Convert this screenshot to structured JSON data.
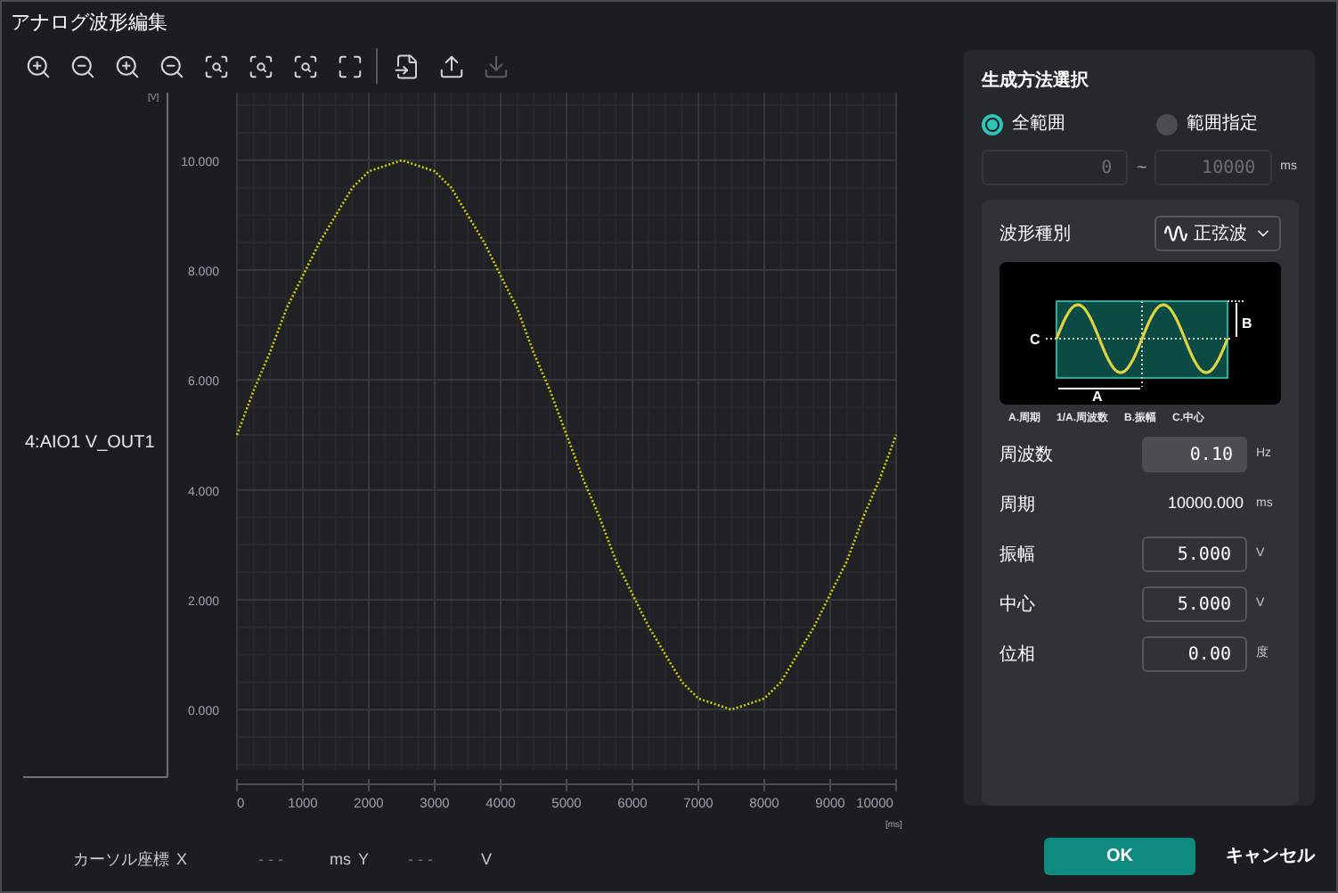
{
  "window": {
    "title": "アナログ波形編集"
  },
  "toolbar_groups": [
    [
      {
        "kind": "zoom-in",
        "disabled": false
      },
      {
        "kind": "zoom-out",
        "disabled": false
      },
      {
        "kind": "zoom-in",
        "disabled": false
      },
      {
        "kind": "zoom-out",
        "disabled": false
      },
      {
        "kind": "zoom-area",
        "disabled": false
      },
      {
        "kind": "zoom-area",
        "disabled": false
      },
      {
        "kind": "zoom-area",
        "disabled": false
      },
      {
        "kind": "fit",
        "disabled": false
      }
    ],
    [
      {
        "kind": "value",
        "disabled": false
      },
      {
        "kind": "export",
        "disabled": false
      },
      {
        "kind": "import",
        "disabled": true
      }
    ]
  ],
  "chart_data": {
    "type": "line",
    "xlabel": "[ms]",
    "ylabel": "[V]",
    "grid": true,
    "x": [
      0,
      250,
      500,
      750,
      1000,
      1250,
      1500,
      1750,
      2000,
      2250,
      2500,
      2750,
      3000,
      3250,
      3500,
      3750,
      4000,
      4250,
      4500,
      4750,
      5000,
      5250,
      5500,
      5750,
      6000,
      6250,
      6500,
      6750,
      7000,
      7250,
      7500,
      7750,
      8000,
      8250,
      8500,
      8750,
      9000,
      9250,
      9500,
      9750,
      10000
    ],
    "series": [
      {
        "name": "4:AIO1 V_OUT1",
        "color": "#d4d000",
        "line_style": "dotted",
        "values": [
          5,
          5.8,
          6.5,
          7.3,
          7.9,
          8.5,
          9,
          9.5,
          9.8,
          9.9,
          10,
          9.9,
          9.8,
          9.5,
          9,
          8.5,
          7.9,
          7.3,
          6.5,
          5.8,
          5,
          4.2,
          3.5,
          2.7,
          2.1,
          1.5,
          1,
          0.5,
          0.2,
          0.1,
          0,
          0.1,
          0.2,
          0.5,
          1,
          1.5,
          2.1,
          2.7,
          3.5,
          4.2,
          5
        ]
      }
    ],
    "xlim": [
      0,
      10000
    ],
    "ylim": [
      -1.1,
      11.23
    ],
    "xticks": [
      0,
      1000,
      2000,
      3000,
      4000,
      5000,
      6000,
      7000,
      8000,
      9000,
      10000
    ],
    "yticks": [
      {
        "value": 0,
        "label": "0.000"
      },
      {
        "value": 2,
        "label": "2.000"
      },
      {
        "value": 4,
        "label": "4.000"
      },
      {
        "value": 6,
        "label": "6.000"
      },
      {
        "value": 8,
        "label": "8.000"
      },
      {
        "value": 10,
        "label": "10.000"
      }
    ]
  },
  "cursor": {
    "label": "カーソル座標",
    "x_label": "X",
    "x_value": "- - -",
    "x_unit": "ms",
    "y_label": "Y",
    "y_value": "- - -",
    "y_unit": "V"
  },
  "panel": {
    "title": "生成方法選択",
    "modes": [
      {
        "label": "全範囲",
        "selected": true
      },
      {
        "label": "範囲指定",
        "selected": false
      }
    ],
    "range": {
      "start": "0",
      "separator": "~",
      "end": "10000",
      "unit": "ms",
      "disabled": true
    },
    "wave_type": {
      "label": "波形種別",
      "value": "正弦波"
    },
    "diagram": {
      "label_a": "A",
      "label_b": "B",
      "label_c": "C"
    },
    "legend": [
      "A.周期",
      "1/A.周波数",
      "B.振幅",
      "C.中心"
    ],
    "params": [
      {
        "kind": "input",
        "label": "周波数",
        "value": "0.10",
        "unit": "Hz",
        "focused": true
      },
      {
        "kind": "readout",
        "label": "周期",
        "value": "10000.000",
        "unit": "ms"
      },
      {
        "kind": "input",
        "label": "振幅",
        "value": "5.000",
        "unit": "V",
        "focused": false
      },
      {
        "kind": "input",
        "label": "中心",
        "value": "5.000",
        "unit": "V",
        "focused": false
      },
      {
        "kind": "input",
        "label": "位相",
        "value": "0.00",
        "unit": "度",
        "focused": false
      }
    ]
  },
  "buttons": [
    {
      "kind": "primary",
      "label": "OK"
    },
    {
      "kind": "secondary",
      "label": "キャンセル"
    }
  ]
}
